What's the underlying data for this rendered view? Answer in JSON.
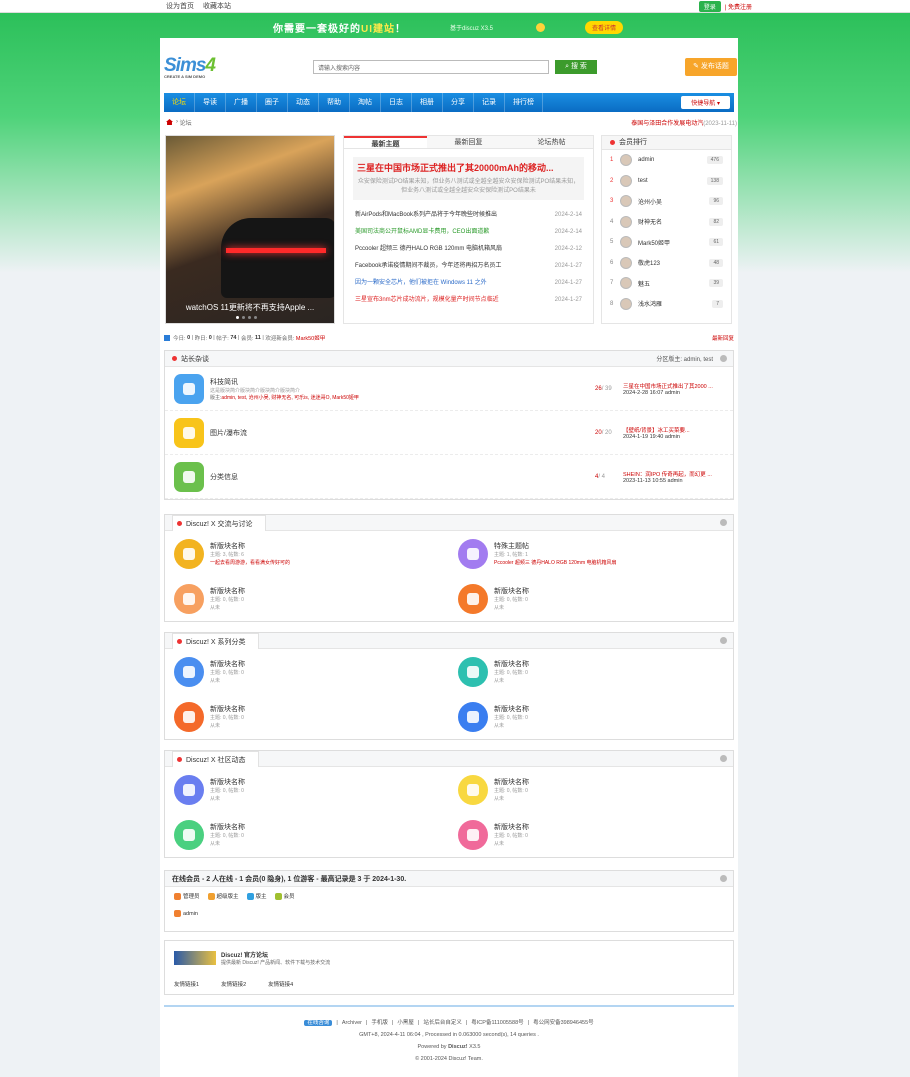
{
  "topbar": {
    "home": "设为首页",
    "fav": "收藏本站",
    "login": "登录",
    "register": "免费注册"
  },
  "banner": {
    "text_a": "你需要一套极好的",
    "text_b": "UI建站",
    "text_c": "！",
    "sub": "基于discuz X3.5",
    "btn": "查看详情"
  },
  "header": {
    "logo_main": "Sims",
    "logo_num": "4",
    "logo_sub": "CREATE A SIM DEMO",
    "search_placeholder": "请输入搜索内容",
    "search_btn": "搜 索",
    "publish_btn": "发布话题"
  },
  "nav": {
    "items": [
      "论坛",
      "导读",
      "广播",
      "圈子",
      "动态",
      "帮助",
      "淘帖",
      "日志",
      "相册",
      "分享",
      "记录",
      "排行榜"
    ],
    "quick": "快捷导航"
  },
  "crumb": {
    "current": "论坛",
    "notice": "泰国与泽田合作发展电动汽",
    "notice_date": "(2023-11-11)"
  },
  "slide": {
    "caption": "watchOS 11更新将不再支持Apple ..."
  },
  "tabs": {
    "items": [
      "最新主题",
      "最新回复",
      "论坛热帖"
    ]
  },
  "hot": {
    "title": "三星在中国市场正式推出了其20000mAh的移动...",
    "desc": "众安保险测试PO结果未知，但业务八测试或全越全越安众安保险测试PO结果未知，但业务八测试或全越全越安众安保险测试PO结果未"
  },
  "threads": [
    {
      "title": "新AirPods和MacBook系列产品将于今年晚些时候推出",
      "date": "2024-2-14",
      "color": "#333"
    },
    {
      "title": "美国司法商公开鼠标AMD显卡费用，CEO出面道歉",
      "date": "2024-2-14",
      "color": "#2a9a2a"
    },
    {
      "title": "Pccooler 超频三 德丹HALO RGB 120mm 电脑机箱风扇",
      "date": "2024-2-12",
      "color": "#333"
    },
    {
      "title": "Facebook承诺疫情期间不裁员，今年还将再招万名员工",
      "date": "2024-1-27",
      "color": "#333"
    },
    {
      "title": "因为一颗安全芯片，他们被拒在 Windows 11 之外",
      "date": "2024-1-27",
      "color": "#2a6ac8"
    },
    {
      "title": "三星宣布3nm芯片成功流片，规模化量产时间节点临近",
      "date": "2024-1-27",
      "color": "#d22"
    }
  ],
  "rank": {
    "title": "会员排行",
    "users": [
      {
        "n": "1",
        "name": "admin",
        "c": "476"
      },
      {
        "n": "2",
        "name": "test",
        "c": "138"
      },
      {
        "n": "3",
        "name": "沧州小吴",
        "c": "96"
      },
      {
        "n": "4",
        "name": "财神无名",
        "c": "82"
      },
      {
        "n": "5",
        "name": "Mark50姬甲",
        "c": "61"
      },
      {
        "n": "6",
        "name": "敬虎123",
        "c": "48"
      },
      {
        "n": "7",
        "name": "魅五",
        "c": "39"
      },
      {
        "n": "8",
        "name": "浅水鸿雁",
        "c": "7"
      }
    ]
  },
  "stats": {
    "today_l": "今日:",
    "today": "0",
    "yest_l": "昨日:",
    "yest": "0",
    "posts_l": "帖子:",
    "posts": "74",
    "mem_l": "会员:",
    "mem": "11",
    "welcome_l": "欢迎新会员:",
    "welcome": "Mark50姬甲",
    "newest": "最新回复"
  },
  "sec1": {
    "title": "站长杂谈",
    "mods": "分区版主: admin, test",
    "forums": [
      {
        "name": "科技简讯",
        "desc": "这是版块简介版块简介版块简介版块简介",
        "mods_l": "版主:",
        "mods": "admin, test, 沧州小吴, 财神无名, 可乐is, 迷迷哥O, Mark50姬甲",
        "count": "26",
        "total": "/ 39",
        "last": "三星在中国市场正式推出了其2000 ...",
        "lastmeta": "2024-2-28 16:07 admin",
        "color": "#4aa3ef"
      },
      {
        "name": "图片/瀑布流",
        "desc": "",
        "mods_l": "",
        "mods": "",
        "count": "20",
        "total": "/ 20",
        "last": "【壁纸/背景】冰工买菜要...",
        "lastmeta": "2024-1-19 19:40 admin",
        "color": "#f8c41a"
      },
      {
        "name": "分类信息",
        "desc": "",
        "mods_l": "",
        "mods": "",
        "count": "4",
        "total": "/ 4",
        "last": "SHEIN：润IPO 传奇再起，而幻更 ...",
        "lastmeta": "2023-11-13 10:55 admin",
        "color": "#6bc04c"
      }
    ]
  },
  "sec2": {
    "title": "Discuz! X 交流与讨论",
    "cells": [
      {
        "name": "新版块名称",
        "meta": "主题: 3, 帖数: 6",
        "extra": "一起去看周游游，看看满女传好可的",
        "color": "#f2b320"
      },
      {
        "name": "特殊主题帖",
        "meta": "主题: 1, 帖数: 1",
        "extra": "Pccooler 超频三 德丹HALO RGB 120mm 电脑机箱风扇",
        "color": "#a27cf0"
      },
      {
        "name": "新版块名称",
        "meta": "主题: 0, 帖数: 0",
        "extra": "从未",
        "color": "#f7a060"
      },
      {
        "name": "新版块名称",
        "meta": "主题: 0, 帖数: 0",
        "extra": "从未",
        "color": "#f4792a"
      }
    ]
  },
  "sec3": {
    "title": "Discuz! X 系列分类",
    "cells": [
      {
        "name": "新版块名称",
        "meta": "主题: 0, 帖数: 0",
        "extra": "从未",
        "color": "#4a8ef0"
      },
      {
        "name": "新版块名称",
        "meta": "主题: 0, 帖数: 0",
        "extra": "从未",
        "color": "#2dc0b0"
      },
      {
        "name": "新版块名称",
        "meta": "主题: 0, 帖数: 0",
        "extra": "从未",
        "color": "#f4692a"
      },
      {
        "name": "新版块名称",
        "meta": "主题: 0, 帖数: 0",
        "extra": "从未",
        "color": "#3a7ef0"
      }
    ]
  },
  "sec4": {
    "title": "Discuz! X 社区动态",
    "cells": [
      {
        "name": "新版块名称",
        "meta": "主题: 0, 帖数: 0",
        "extra": "从未",
        "color": "#6a7ef0"
      },
      {
        "name": "新版块名称",
        "meta": "主题: 0, 帖数: 0",
        "extra": "从未",
        "color": "#f8d840"
      },
      {
        "name": "新版块名称",
        "meta": "主题: 0, 帖数: 0",
        "extra": "从未",
        "color": "#4ad080"
      },
      {
        "name": "新版块名称",
        "meta": "主题: 0, 帖数: 0",
        "extra": "从未",
        "color": "#f06a9a"
      }
    ]
  },
  "online": {
    "title": "在线会员 - 2 人在线 - 1 会员(0 隐身), 1 位游客 - 最高记录是 3 于 2024-1-30.",
    "groups": [
      {
        "label": "管理员",
        "color": "#f08030"
      },
      {
        "label": "超级版主",
        "color": "#f0a030"
      },
      {
        "label": "版主",
        "color": "#30a0e0"
      },
      {
        "label": "会员",
        "color": "#a0c030"
      }
    ],
    "user": "admin"
  },
  "links": {
    "title": "Discuz! 官方论坛",
    "desc": "提供最新 Discuz! 产品新闻、软件下载与技术交流",
    "items": [
      "友情链接1",
      "友情链接2",
      "友情链接4"
    ]
  },
  "footer": {
    "online_btn": "在线咨询",
    "items": [
      "Archiver",
      "手机版",
      "小黑屋",
      "站长后台自定义",
      "粤ICP备111005588号",
      "粤公网安备398946455号"
    ],
    "line2": "GMT+8, 2024-4-11 06:04 , Processed in 0.063000 second(s), 14 queries .",
    "line3_a": "Powered by",
    "line3_b": "Discuz!",
    "line3_c": "X3.5",
    "line4": "© 2001-2024 Discuz! Team."
  }
}
